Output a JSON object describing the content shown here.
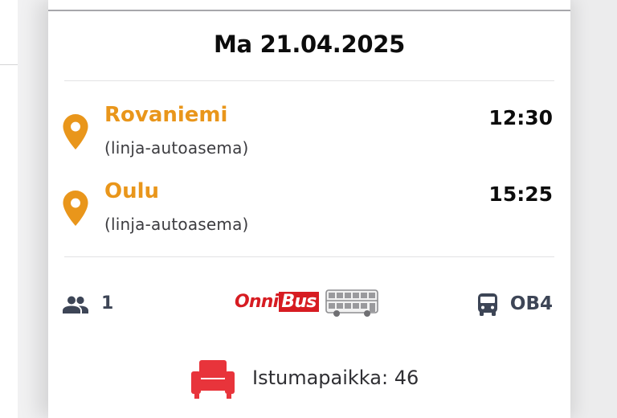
{
  "trip": {
    "date": "Ma 21.04.2025",
    "departure": {
      "city": "Rovaniemi",
      "place": "(linja-autoasema)",
      "time": "12:30"
    },
    "arrival": {
      "city": "Oulu",
      "place": "(linja-autoasema)",
      "time": "15:25"
    }
  },
  "info": {
    "passengers": "1",
    "operator_logo_text": "OnniBus",
    "route_code": "OB4"
  },
  "seat": {
    "label": "Istumapaikka: 46"
  },
  "icons": {
    "pin": "location-pin-icon",
    "people": "people-icon",
    "bus": "bus-icon",
    "seat": "seat-icon"
  },
  "colors": {
    "accent_orange": "#e9961b",
    "brand_red": "#d71c22",
    "seat_red": "#e8343b",
    "icon_navy": "#3d4556"
  }
}
